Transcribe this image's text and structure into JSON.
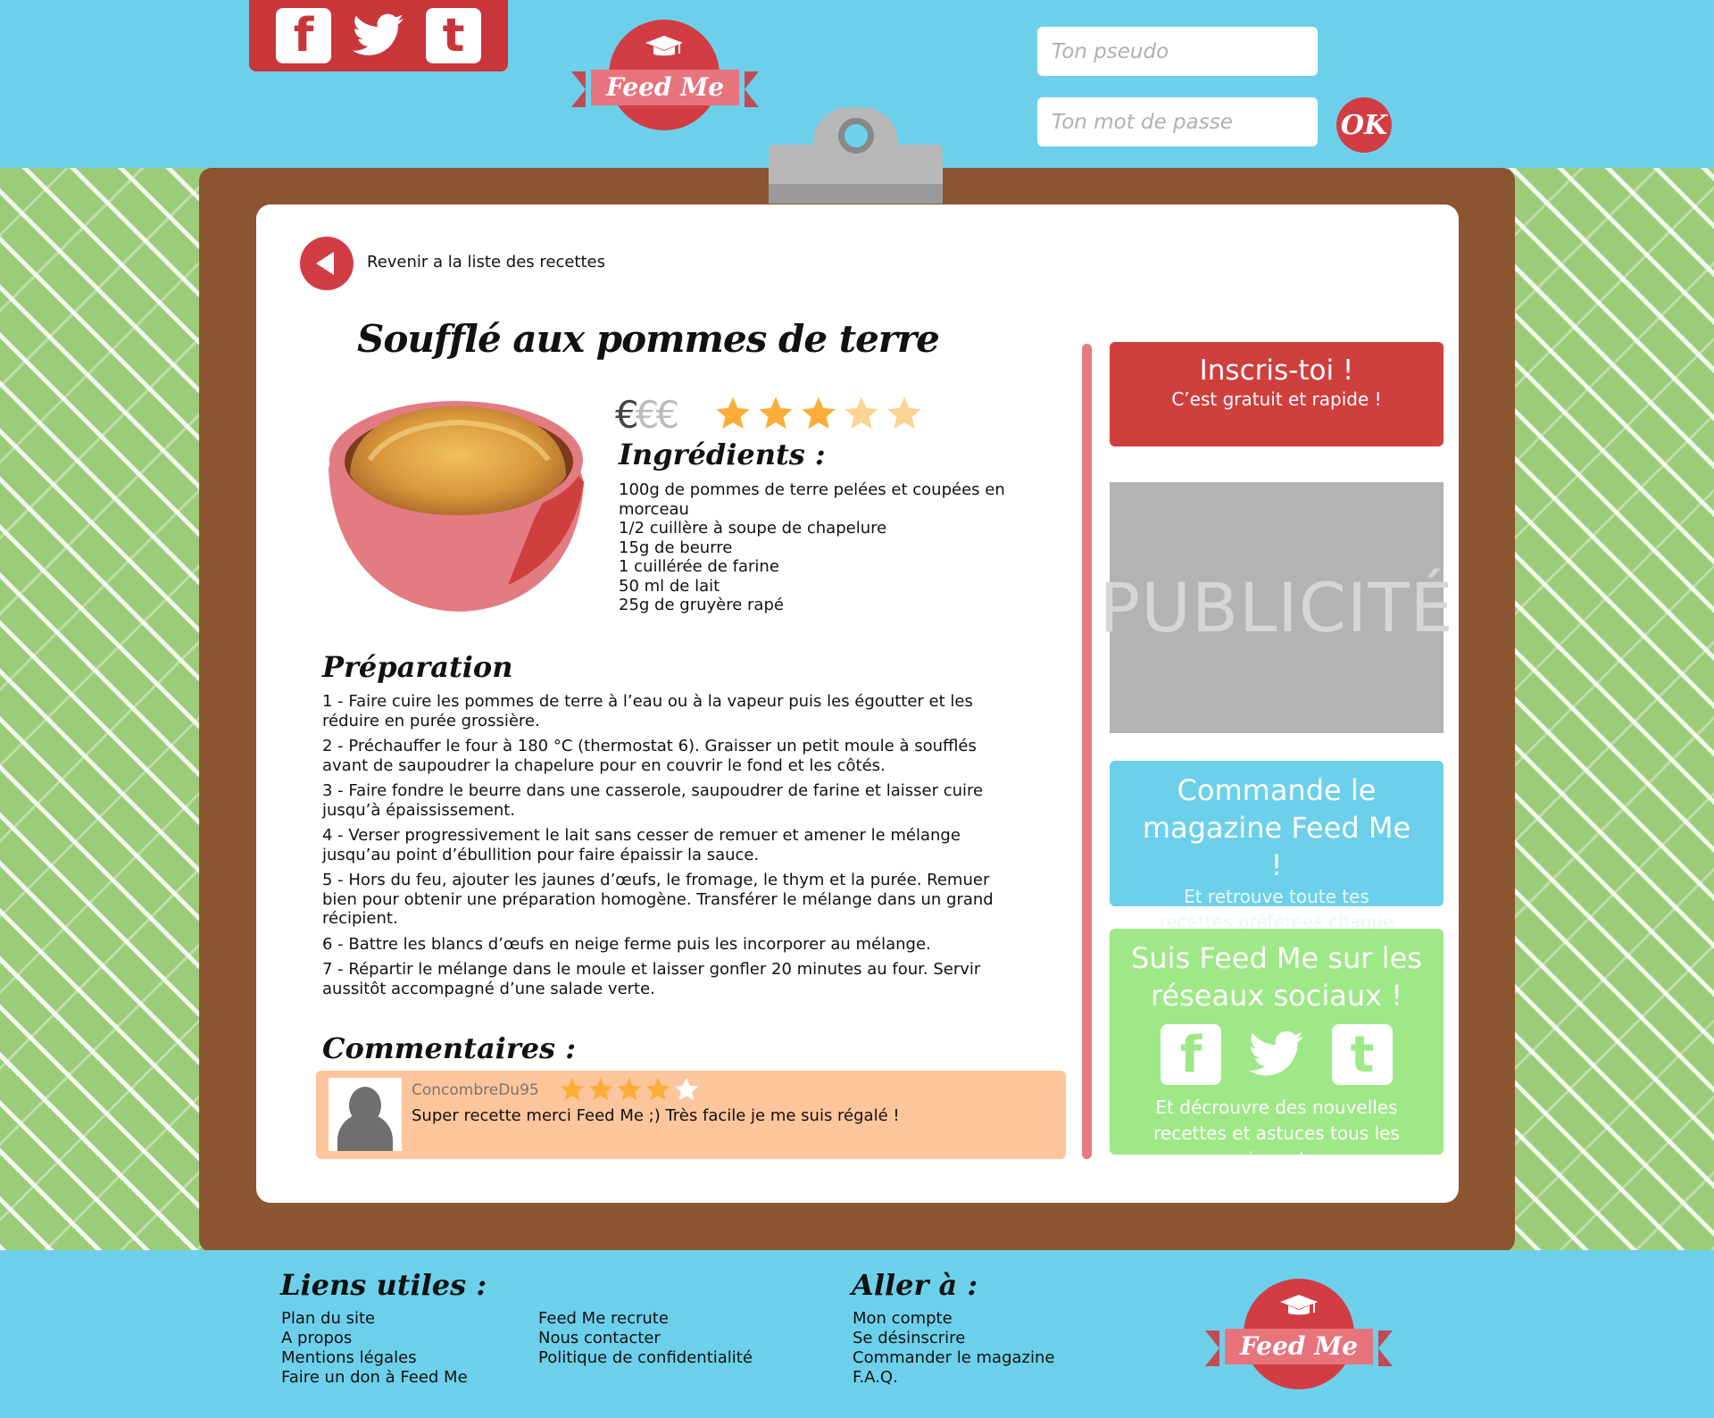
{
  "header": {
    "social": [
      {
        "name": "facebook-icon",
        "glyph": "f"
      },
      {
        "name": "twitter-icon",
        "glyph": ""
      },
      {
        "name": "tumblr-icon",
        "glyph": "t"
      }
    ],
    "logo_text": "Feed Me",
    "pseudo_placeholder": "Ton pseudo",
    "password_placeholder": "Ton mot de passe",
    "ok_label": "OK"
  },
  "recipe": {
    "back_label": "Revenir a la liste des recettes",
    "title": "Soufflé aux pommes de terre",
    "price_on": "€",
    "price_off": "€€",
    "rating": 3.5,
    "rating_max": 5,
    "ingredients_title": "Ingrédients :",
    "ingredients": [
      "100g de pommes de terre pelées et coupées en morceau",
      "1/2 cuillère à soupe de chapelure",
      "15g de beurre",
      "1 cuillérée de farine",
      "50 ml de lait",
      "25g de gruyère rapé"
    ],
    "preparation_title": "Préparation",
    "steps": [
      "1 - Faire cuire les pommes de terre à l’eau ou à la vapeur puis les égoutter et les réduire en purée grossière.",
      "2 - Préchauffer le four à 180 °C (thermostat 6). Graisser un petit moule à soufflés avant de saupoudrer la chapelure pour en couvrir le fond et les côtés.",
      "3 - Faire fondre le beurre dans une casserole, saupoudrer de farine et laisser cuire jusqu’à épaississement.",
      "4 - Verser progressivement le lait sans cesser de remuer et amener le mélange jusqu’au point d’ébullition pour faire épaissir la sauce.",
      "5 - Hors du feu, ajouter les jaunes d’œufs, le fromage, le thym et la purée. Remuer bien pour obtenir une préparation homogène. Transférer le mélange dans un grand récipient.",
      "6 - Battre les blancs d’œufs en neige ferme puis les incorporer au mélange.",
      "7 - Répartir le mélange dans le moule et laisser gonfler 20 minutes au four. Servir aussitôt accompagné d’une salade verte."
    ],
    "comments_title": "Commentaires :",
    "comments": [
      {
        "user": "ConcombreDu95",
        "rating": 4,
        "text": "Super recette merci Feed Me ;) Très facile je me suis régalé !"
      }
    ]
  },
  "sidebar": {
    "signup_title": "Inscris-toi !",
    "signup_sub": "C’est gratuit et rapide !",
    "ad_label": "PUBLICITÉ",
    "magazine_title": "Commande le magazine Feed Me !",
    "magazine_sub": "Et retrouve toute tes recettes préférées chaque mois !",
    "follow_title": "Suis Feed Me sur les réseaux sociaux !",
    "follow_sub": "Et décrouvre des nouvelles recettes et astuces tous les jours !"
  },
  "footer": {
    "useful_title": "Liens utiles :",
    "useful_col1": [
      "Plan du site",
      "A propos",
      "Mentions légales",
      "Faire un don à Feed Me"
    ],
    "useful_col2": [
      "Feed Me recrute",
      "Nous contacter",
      "Politique de confidentialité"
    ],
    "goto_title": "Aller à :",
    "goto_links": [
      "Mon compte",
      "Se désinscrire",
      "Commander le magazine",
      "F.A.Q."
    ],
    "logo_text": "Feed Me"
  },
  "colors": {
    "sky": "#6dd0ea",
    "brand_red": "#d23d44",
    "board_brown": "#8a5530",
    "pattern_green": "#9ccc7a",
    "star": "#fcad38"
  }
}
